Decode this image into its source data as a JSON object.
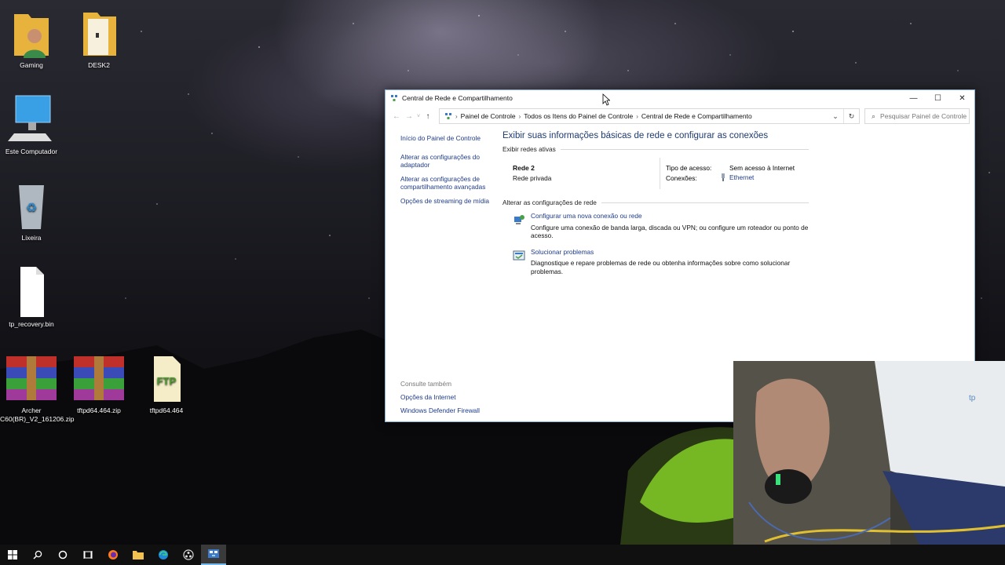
{
  "desktop": {
    "icons": [
      {
        "label": "Gaming"
      },
      {
        "label": "DESK2"
      },
      {
        "label": "Este Computador"
      },
      {
        "label": "Lixeira"
      },
      {
        "label": "tp_recovery.bin"
      },
      {
        "label": "Archer C60(BR)_V2_161206.zip"
      },
      {
        "label": "tftpd64.464.zip"
      },
      {
        "label": "tftpd64.464"
      }
    ]
  },
  "window": {
    "title": "Central de Rede e Compartilhamento",
    "controls": {
      "minimize": "—",
      "maximize": "☐",
      "close": "✕"
    },
    "breadcrumb": [
      "Painel de Controle",
      "Todos os Itens do Painel de Controle",
      "Central de Rede e Compartilhamento"
    ],
    "search_placeholder": "Pesquisar Painel de Controle",
    "sidebar": {
      "home": "Início do Painel de Controle",
      "links": [
        "Alterar as configurações do adaptador",
        "Alterar as configurações de compartilhamento avançadas",
        "Opções de streaming de mídia"
      ],
      "see_also_header": "Consulte também",
      "see_also": [
        "Opções da Internet",
        "Windows Defender Firewall"
      ]
    },
    "main": {
      "heading": "Exibir suas informações básicas de rede e configurar as conexões",
      "active_networks_label": "Exibir redes ativas",
      "network": {
        "name": "Rede 2",
        "type": "Rede privada",
        "access_type_label": "Tipo de acesso:",
        "access_type_value": "Sem acesso à Internet",
        "connections_label": "Conexões:",
        "connections_value": "Ethernet"
      },
      "change_settings_label": "Alterar as configurações de rede",
      "tasks": [
        {
          "link": "Configurar uma nova conexão ou rede",
          "desc": "Configure uma conexão de banda larga, discada ou VPN; ou configure um roteador ou ponto de acesso."
        },
        {
          "link": "Solucionar problemas",
          "desc": "Diagnostique e repare problemas de rede ou obtenha informações sobre como solucionar problemas."
        }
      ]
    }
  },
  "taskbar": {
    "items": [
      "start-icon",
      "search-icon",
      "cortana-icon",
      "task-view-icon",
      "firefox-icon",
      "file-explorer-icon",
      "edge-icon",
      "obs-icon",
      "control-panel-icon"
    ]
  },
  "colors": {
    "link": "#1e3b8a",
    "heading": "#1e3b6f",
    "window_border": "#8ab0d6",
    "taskbar": "#101010"
  }
}
